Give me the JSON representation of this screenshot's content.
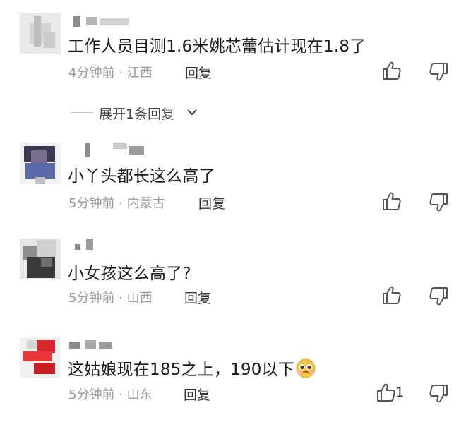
{
  "comments": [
    {
      "text": "工作人员目测1.6米姚芯蕾估计现在1.8了",
      "time": "4分钟前",
      "location": "江西",
      "reply_label": "回复",
      "likes": "",
      "expand_label": "展开1条回复"
    },
    {
      "text": "小丫头都长这么高了",
      "time": "5分钟前",
      "location": "内蒙古",
      "reply_label": "回复",
      "likes": ""
    },
    {
      "text": "小女孩这么高了?",
      "time": "5分钟前",
      "location": "山西",
      "reply_label": "回复",
      "likes": ""
    },
    {
      "text": "这姑娘现在185之上，190以下",
      "time": "5分钟前",
      "location": "山东",
      "reply_label": "回复",
      "likes": "1"
    }
  ],
  "meta_separator": " · ",
  "icons": [
    "thumbs-up-icon",
    "thumbs-down-icon",
    "chevron-down-icon",
    "pleading-face-emoji"
  ],
  "colors": {
    "meta_text": "#9a9a9a",
    "comment_text": "#1a1a1a",
    "reply_text": "#333333",
    "emoji": "#f6c54a"
  }
}
